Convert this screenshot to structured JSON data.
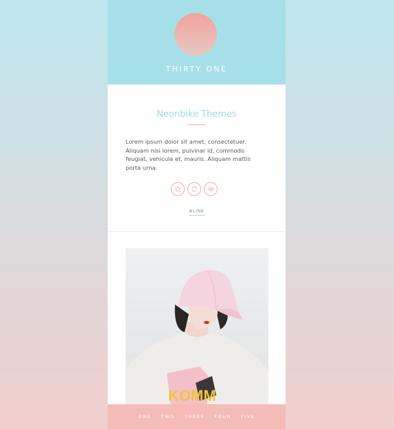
{
  "blog": {
    "title": "THIRTY ONE"
  },
  "post": {
    "title": "Neonbike Themes",
    "body": "Lorem ipsum dolor sit amet, consectetuer. Aliquam nisi lorem, pulvinar id, commodo feugiat, vehicula et, mauris. Aliquam mattis porta urna.",
    "tag": "#LINK",
    "actions": [
      "star-icon",
      "reblog-icon",
      "eye-icon"
    ]
  },
  "photo": {
    "overlay_text": "KOMM"
  },
  "footer": {
    "links": [
      "ONE",
      "TWO",
      "THREE",
      "FOUR",
      "FIVE"
    ]
  },
  "colors": {
    "header": "#a5e0e8",
    "accent_pink": "#f0a9a4",
    "title_blue": "#9fd9e3",
    "footer": "#f4bbb7"
  }
}
